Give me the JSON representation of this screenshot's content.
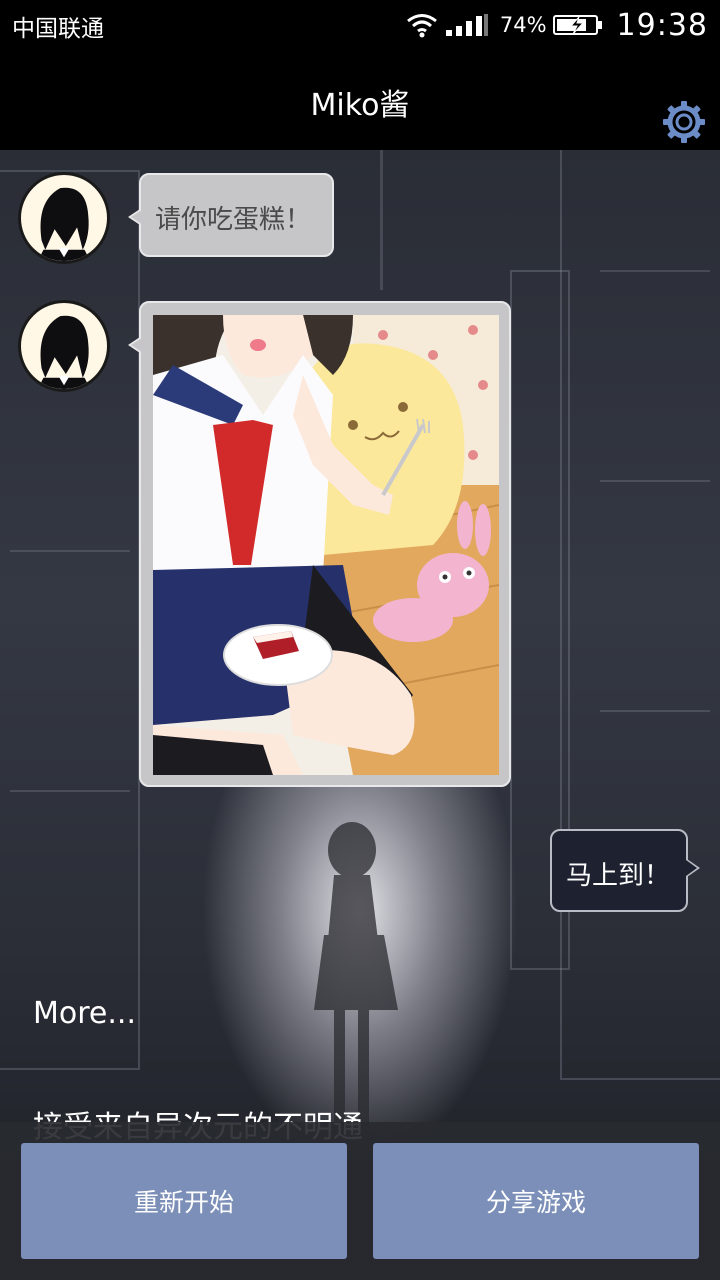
{
  "status_bar": {
    "carrier": "中国联通",
    "battery_percent": "74%",
    "time": "19:38",
    "icons": [
      "wifi-icon",
      "signal-icon",
      "battery-charging-icon"
    ]
  },
  "header": {
    "title": "Miko酱",
    "settings_icon": "gear-icon"
  },
  "chat": {
    "messages": [
      {
        "from": "npc",
        "type": "text",
        "text": "请你吃蛋糕！"
      },
      {
        "from": "npc",
        "type": "image"
      },
      {
        "from": "player",
        "type": "text",
        "text": "马上到！"
      }
    ]
  },
  "more_label": "More...",
  "preview_text": "接受来自异次元的不明通",
  "buttons": {
    "restart": "重新开始",
    "share": "分享游戏"
  },
  "colors": {
    "button": "#7b8fb8",
    "gear": "#6b8cc6",
    "npc_bubble": "#c6c6c8",
    "player_bubble": "#1e2230"
  }
}
